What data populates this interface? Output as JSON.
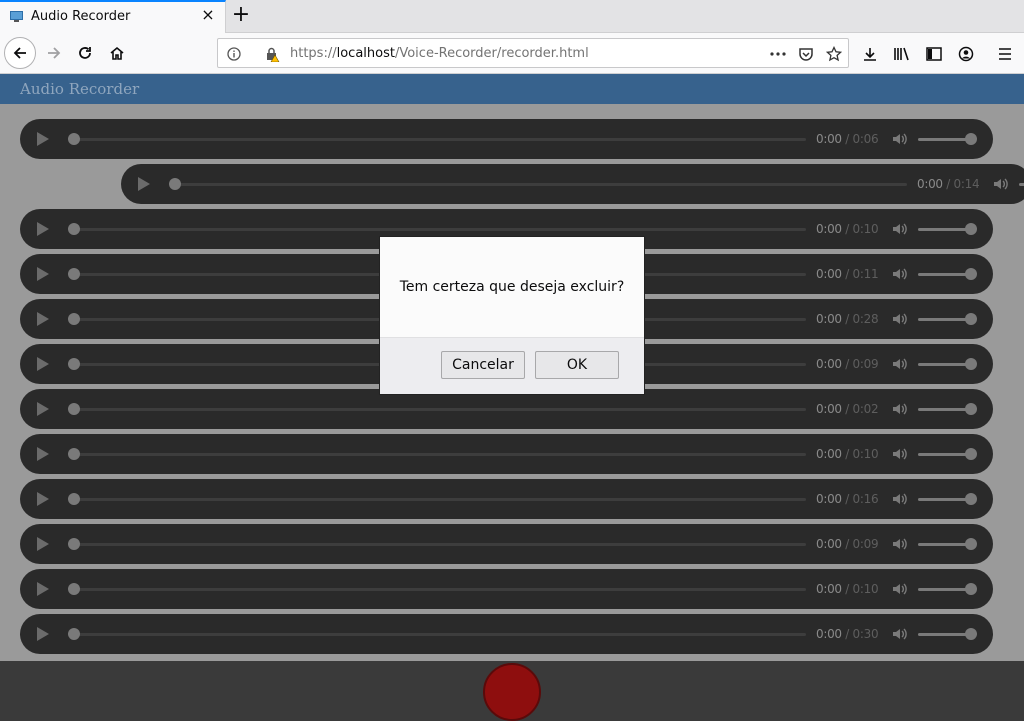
{
  "browser": {
    "tab": {
      "title": "Audio Recorder",
      "favicon": "monitor-icon"
    },
    "url": {
      "scheme": "https://",
      "host": "localhost",
      "path": "/Voice-Recorder/recorder.html"
    },
    "icons": [
      "back-icon",
      "forward-icon",
      "reload-icon",
      "home-icon",
      "info-icon",
      "insecure-lock-icon",
      "more-icon",
      "pocket-icon",
      "bookmark-star-icon",
      "download-icon",
      "library-icon",
      "sidebar-icon",
      "account-icon",
      "menu-icon"
    ]
  },
  "app": {
    "title": "Audio Recorder",
    "colors": {
      "header": "#37628d",
      "record": "#8e0e0e"
    },
    "players": [
      {
        "current": "0:00",
        "total": "0:06"
      },
      {
        "current": "0:00",
        "total": "0:14"
      },
      {
        "current": "0:00",
        "total": "0:10"
      },
      {
        "current": "0:00",
        "total": "0:11"
      },
      {
        "current": "0:00",
        "total": "0:28"
      },
      {
        "current": "0:00",
        "total": "0:09"
      },
      {
        "current": "0:00",
        "total": "0:02"
      },
      {
        "current": "0:00",
        "total": "0:10"
      },
      {
        "current": "0:00",
        "total": "0:16"
      },
      {
        "current": "0:00",
        "total": "0:09"
      },
      {
        "current": "0:00",
        "total": "0:10"
      },
      {
        "current": "0:00",
        "total": "0:30"
      }
    ]
  },
  "dialog": {
    "message": "Tem certeza que deseja excluir?",
    "cancel_label": "Cancelar",
    "ok_label": "OK"
  }
}
